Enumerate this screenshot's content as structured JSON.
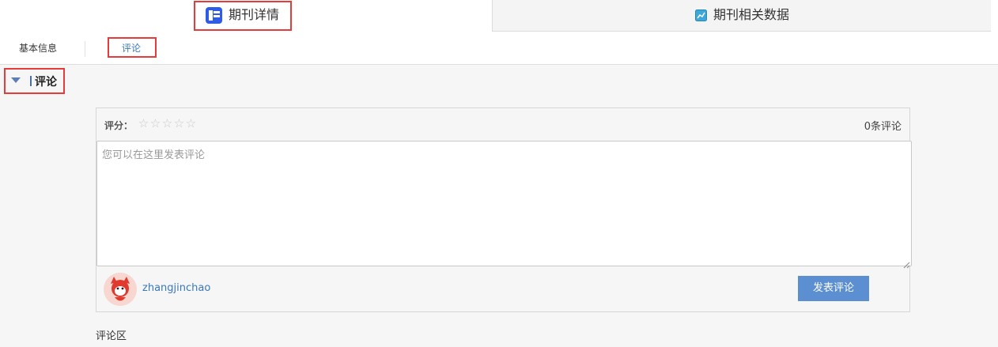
{
  "tabs": {
    "main_label": "期刊详情",
    "side_label": "期刊相关数据",
    "main_icon": "journal-detail-icon",
    "side_icon": "chart-icon"
  },
  "subnav": {
    "basic_info": "基本信息",
    "comments": "评论"
  },
  "section": {
    "title": "评论"
  },
  "comment_form": {
    "rating_label": "评分：",
    "stars": [
      "☆",
      "☆",
      "☆",
      "☆",
      "☆"
    ],
    "count_text": "0条评论",
    "placeholder": "您可以在这里发表评论",
    "username": "zhangjinchao",
    "submit_label": "发表评论"
  },
  "comment_zone_label": "评论区",
  "colors": {
    "highlight": "#e53b3b",
    "button": "#5b8fd1",
    "link": "#3a79b8"
  }
}
